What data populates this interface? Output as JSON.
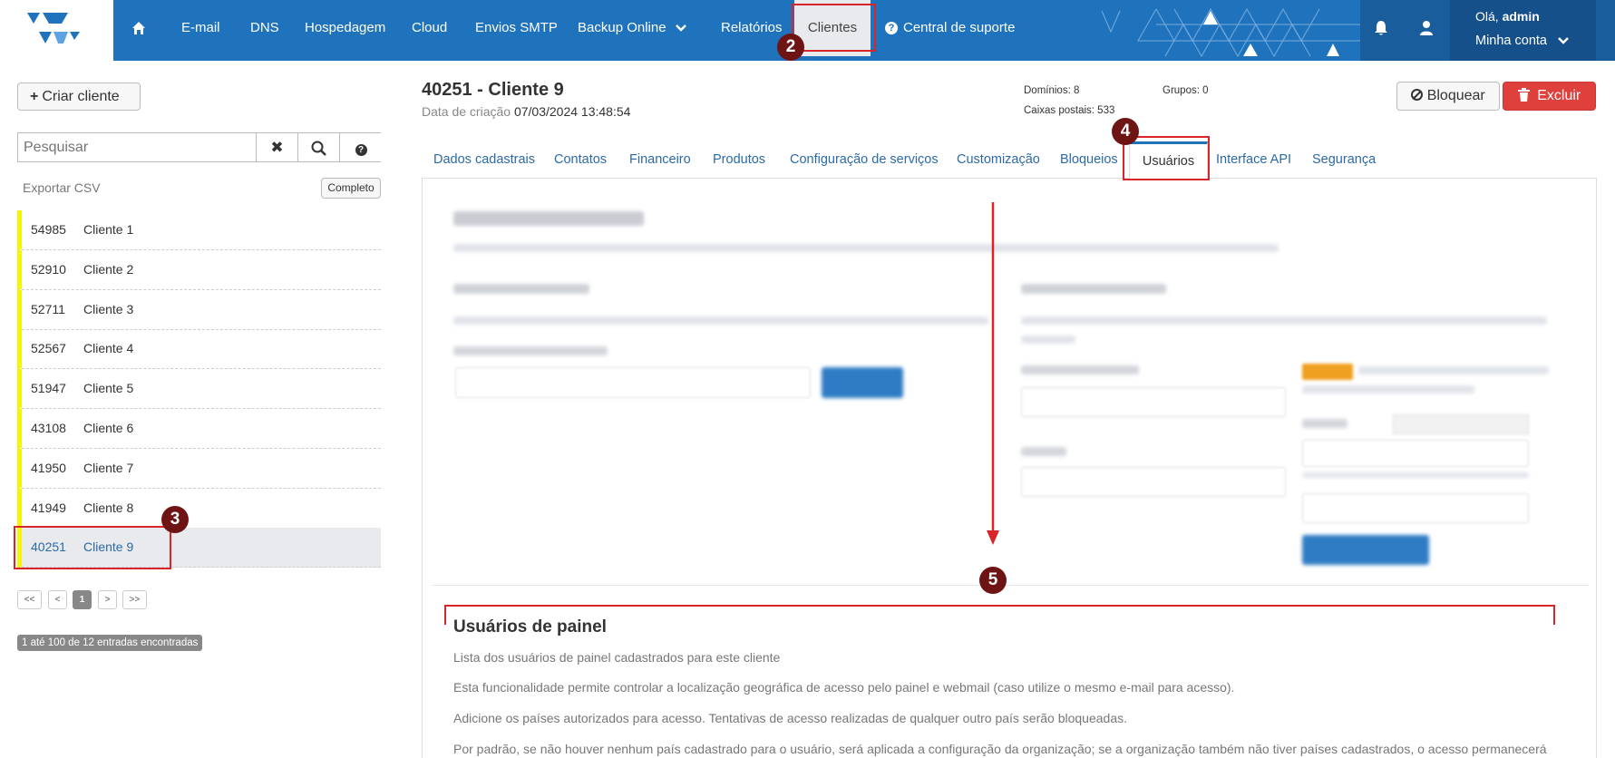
{
  "nav": {
    "items": [
      "E-mail",
      "DNS",
      "Hospedagem",
      "Cloud",
      "Envios SMTP",
      "Backup Online",
      "Relatórios",
      "Clientes",
      "Central de suporte"
    ],
    "active": "Clientes",
    "greeting_prefix": "Olá,",
    "user": "admin",
    "account_label": "Minha conta"
  },
  "annotations": {
    "n2": "2",
    "n3": "3",
    "n4": "4",
    "n5": "5"
  },
  "sidebar": {
    "create_button": "Criar cliente",
    "search_placeholder": "Pesquisar",
    "export_csv": "Exportar CSV",
    "complete_button": "Completo",
    "clients": [
      {
        "id": "54985",
        "name": "Cliente 1"
      },
      {
        "id": "52910",
        "name": "Cliente 2"
      },
      {
        "id": "52711",
        "name": "Cliente 3"
      },
      {
        "id": "52567",
        "name": "Cliente 4"
      },
      {
        "id": "51947",
        "name": "Cliente 5"
      },
      {
        "id": "43108",
        "name": "Cliente 6"
      },
      {
        "id": "41950",
        "name": "Cliente 7"
      },
      {
        "id": "41949",
        "name": "Cliente 8"
      },
      {
        "id": "40251",
        "name": "Cliente 9"
      }
    ],
    "pagination": [
      "<<",
      "<",
      "1",
      ">",
      ">>"
    ],
    "entries_label": "1 até 100 de 12 entradas encontradas"
  },
  "client": {
    "title": "40251 - Cliente 9",
    "created_label": "Data de criação",
    "created_value": "07/03/2024 13:48:54",
    "domains": "Domínios: 8",
    "mailboxes": "Caixas postais: 533",
    "groups": "Grupos: 0",
    "block_button": "Bloquear",
    "delete_button": "Excluir"
  },
  "tabs": [
    "Dados cadastrais",
    "Contatos",
    "Financeiro",
    "Produtos",
    "Configuração de serviços",
    "Customização",
    "Bloqueios",
    "Usuários",
    "Interface API",
    "Segurança"
  ],
  "active_tab": "Usuários",
  "panel_users": {
    "title": "Usuários de painel",
    "lines": [
      "Lista dos usuários de painel cadastrados para este cliente",
      "Esta funcionalidade permite controlar a localização geográfica de acesso pelo painel e webmail (caso utilize o mesmo e-mail para acesso).",
      "Adicione os países autorizados para acesso. Tentativas de acesso realizadas de qualquer outro país serão bloqueadas.",
      "Por padrão, se não houver nenhum país cadastrado para o usuário, será aplicada a configuração da organização; se a organização também não tiver países cadastrados, o acesso permanecerá"
    ]
  },
  "colors": {
    "nav_bg": "#1f73bd",
    "annotation_red": "#d9252a",
    "badge_dark_red": "#6e1414",
    "delete_red": "#e0403c",
    "client_marker_yellow": "#f5f50a"
  }
}
